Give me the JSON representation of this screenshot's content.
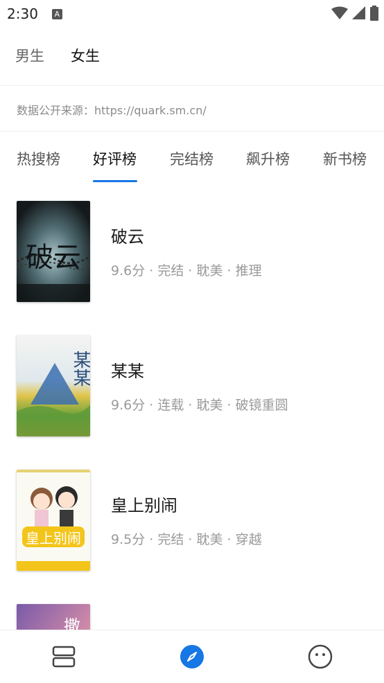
{
  "status_bar": {
    "time": "2:30",
    "notification_icon": "A",
    "icons": [
      "wifi-icon",
      "signal-icon",
      "battery-icon"
    ]
  },
  "gender_tabs": [
    {
      "label": "男生",
      "active": false
    },
    {
      "label": "女生",
      "active": true
    }
  ],
  "source_note": "数据公开来源：https://quark.sm.cn/",
  "rank_tabs": [
    {
      "label": "热搜榜",
      "active": false
    },
    {
      "label": "好评榜",
      "active": true
    },
    {
      "label": "完结榜",
      "active": false
    },
    {
      "label": "飙升榜",
      "active": false
    },
    {
      "label": "新书榜",
      "active": false
    }
  ],
  "books": [
    {
      "title": "破云",
      "meta": "9.6分 · 完结 · 耽美 · 推理",
      "cover_text": "破云"
    },
    {
      "title": "某某",
      "meta": "9.6分 · 连载 · 耽美 · 破镜重圆",
      "cover_text": "某某"
    },
    {
      "title": "皇上别闹",
      "meta": "9.5分 · 完结 · 耽美 · 穿越",
      "cover_text": "皇上别闹"
    },
    {
      "title": "",
      "meta": "",
      "cover_text": "撒"
    }
  ],
  "bottom_nav": [
    {
      "icon": "bookshelf-icon",
      "active": false
    },
    {
      "icon": "compass-icon",
      "active": true
    },
    {
      "icon": "profile-face-icon",
      "active": false
    }
  ],
  "colors": {
    "accent": "#1677e5",
    "text_primary": "#1a1a1a",
    "text_secondary": "#9a9a9a"
  }
}
